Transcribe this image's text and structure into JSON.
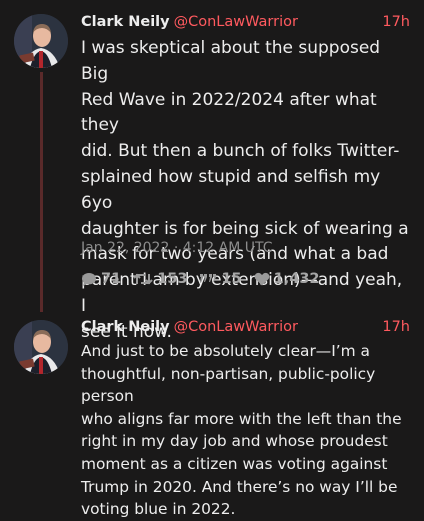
{
  "tweets": [
    {
      "name": "Clark Neily",
      "handle": "@ConLawWarrior",
      "time": "17h",
      "lines": [
        "I was skeptical about the supposed Big",
        "Red Wave in 2022/2024 after what they",
        "did. But then a bunch of folks Twitter-",
        "splained how stupid and selfish my 6yo",
        "daughter is for being sick of wearing a",
        "mask for two years (and what a bad",
        "parent I am by extension)—and yeah, I",
        "see it now."
      ],
      "date": "Jan 22, 2022 · 4:12 AM UTC",
      "stats": {
        "replies": "71",
        "retweets": "153",
        "quotes": "15",
        "likes": "1,432"
      }
    },
    {
      "name": "Clark Neily",
      "handle": "@ConLawWarrior",
      "time": "17h",
      "lines": [
        "And just to be absolutely clear—I’m a",
        "thoughtful, non-partisan, public-policy person",
        "who aligns far more with the left than the",
        "right in my day job and whose proudest",
        "moment as a citizen was voting against",
        "Trump in 2020. And there’s no way I’ll be",
        "voting blue in 2022."
      ]
    }
  ],
  "colors": {
    "accent": "#ff5a5f",
    "background": "#1a1919",
    "thread": "#5a2a2a"
  },
  "icons": {
    "replies": "comment-icon",
    "retweets": "retweet-icon",
    "quotes": "quote-icon",
    "likes": "heart-icon"
  }
}
